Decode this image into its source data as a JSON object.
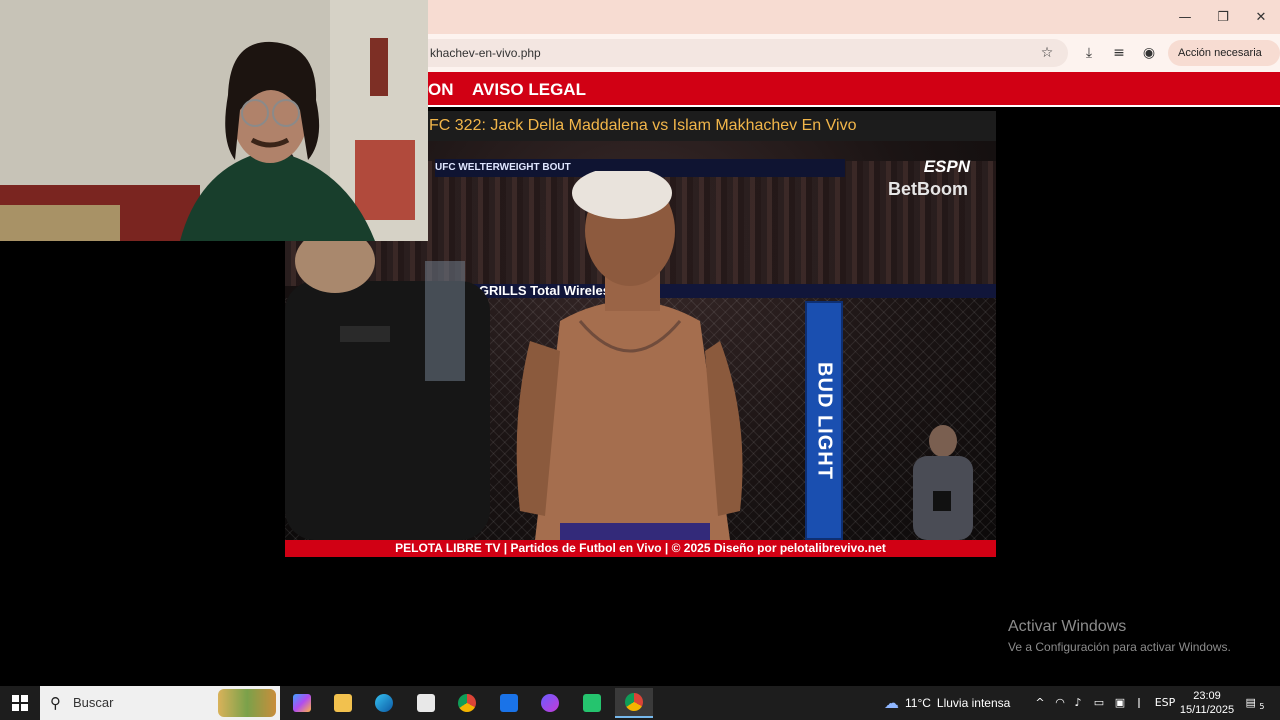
{
  "browser": {
    "url_fragment": "khachev-en-vivo.php",
    "action_label": "Acción necesaria",
    "window_controls": {
      "minimize": "—",
      "restore": "❐",
      "close": "✕"
    },
    "icons": [
      "star-icon",
      "download-icon",
      "media-control-icon",
      "profile-icon",
      "menu-dots-icon"
    ]
  },
  "site": {
    "nav": {
      "item_1": "ON",
      "item_2": "AVISO LEGAL"
    },
    "page_title": "FC 322: Jack Della Maddalena vs Islam Makhachev En Vivo",
    "footer": "PELOTA LIBRE TV | Partidos de Futbol en Vivo | © 2025 Diseño por pelotalibrevivo.net",
    "colors": {
      "brand_red": "#d10014",
      "title_orange": "#f2b64a"
    }
  },
  "video": {
    "broadcaster": "ESPN",
    "sponsor": "BetBoom",
    "cage_banner": "UFC WELTERWEIGHT BOUT",
    "rail_text": "PIT   GRILLS                          Total Wireles",
    "pillar_text": "BUD LIGHT"
  },
  "watermark": {
    "line1": "Activar Windows",
    "line2": "Ve a Configuración para activar Windows."
  },
  "taskbar": {
    "search_placeholder": "Buscar",
    "weather_temp": "11°C",
    "weather_desc": "Lluvia intensa",
    "lang": "ESP",
    "time": "23:09",
    "date": "15/11/2025",
    "notification_count": "5",
    "apps": [
      "copilot-icon",
      "file-explorer-icon",
      "edge-icon",
      "store-icon",
      "chrome-icon",
      "outlook-icon",
      "messenger-icon",
      "app-icon",
      "chrome-active-icon"
    ]
  }
}
